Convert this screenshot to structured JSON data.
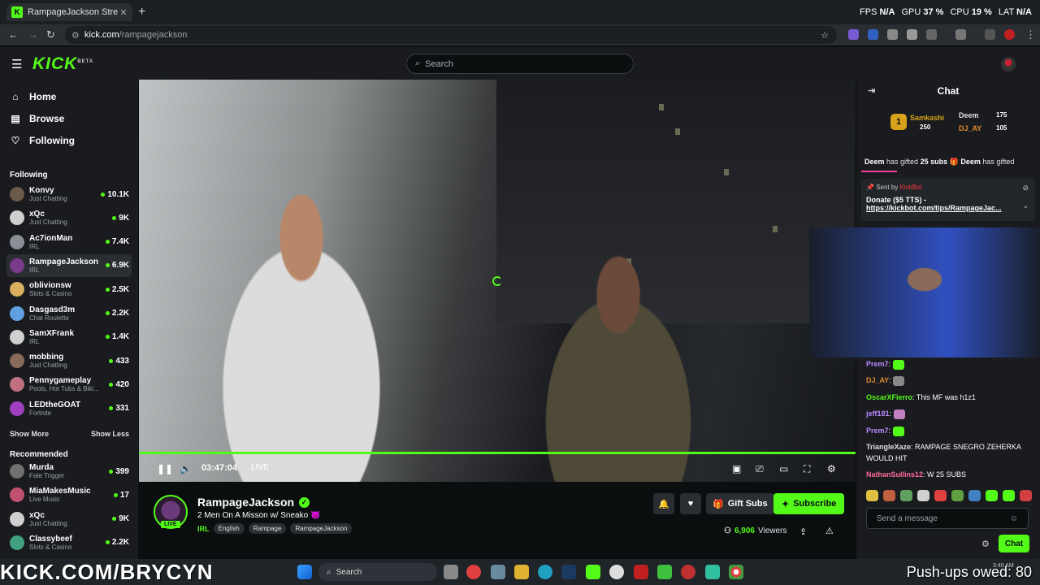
{
  "browser": {
    "tab_title": "RampageJackson Stream - ",
    "url_host": "kick.com",
    "url_path": "/rampagejackson",
    "perf": {
      "fps_label": "FPS",
      "fps": "N/A",
      "gpu_label": "GPU",
      "gpu": "37 %",
      "cpu_label": "CPU",
      "cpu": "19 %",
      "lat_label": "LAT",
      "lat": "N/A"
    }
  },
  "header": {
    "logo": "KICK",
    "logo_sup": "BETA",
    "search_placeholder": "Search"
  },
  "sidebar": {
    "nav": [
      {
        "label": "Home"
      },
      {
        "label": "Browse"
      },
      {
        "label": "Following"
      }
    ],
    "following_title": "Following",
    "following": [
      {
        "name": "Konvy",
        "category": "Just Chatting",
        "viewers": "10.1K",
        "color": "#6a5a4a"
      },
      {
        "name": "xQc",
        "category": "Just Chatting",
        "viewers": "9K",
        "color": "#cfcfcf"
      },
      {
        "name": "Ac7ionMan",
        "category": "IRL",
        "viewers": "7.4K",
        "color": "#8a8f95"
      },
      {
        "name": "RampageJackson",
        "category": "IRL",
        "viewers": "6.9K",
        "color": "#7a3a8a"
      },
      {
        "name": "oblivionsw",
        "category": "Slots & Casino",
        "viewers": "2.5K",
        "color": "#d8b060"
      },
      {
        "name": "Dasgasd3m",
        "category": "Chat Roulette",
        "viewers": "2.2K",
        "color": "#60a0e0"
      },
      {
        "name": "SamXFrank",
        "category": "IRL",
        "viewers": "1.4K",
        "color": "#d0d0d0"
      },
      {
        "name": "mobbing",
        "category": "Just Chatting",
        "viewers": "433",
        "color": "#8a6a5a"
      },
      {
        "name": "Pennygameplay",
        "category": "Pools, Hot Tubs & Biki...",
        "viewers": "420",
        "color": "#c07080"
      },
      {
        "name": "LEDtheGOAT",
        "category": "Fortnite",
        "viewers": "331",
        "color": "#a040c0"
      }
    ],
    "show_more": "Show More",
    "show_less": "Show Less",
    "recommended_title": "Recommended",
    "recommended": [
      {
        "name": "Murda",
        "category": "Fate Trigger",
        "viewers": "399",
        "color": "#707070"
      },
      {
        "name": "MiaMakesMusic",
        "category": "Live Music",
        "viewers": "17",
        "color": "#c05070"
      },
      {
        "name": "xQc",
        "category": "Just Chatting",
        "viewers": "9K",
        "color": "#cfcfcf"
      },
      {
        "name": "Classybeef",
        "category": "Slots & Casino",
        "viewers": "2.2K",
        "color": "#40a080"
      }
    ]
  },
  "player": {
    "time": "03:47:04",
    "live": "LIVE",
    "progress": 1.0
  },
  "stream": {
    "streamer": "RampageJackson",
    "title": "2 Men On A Misson w/ Sneako",
    "title_emote": "😈",
    "live_badge": "LIVE",
    "category": "IRL",
    "tags": [
      "English",
      "Rampage",
      "RampageJackson"
    ],
    "gift_label": "Gift Subs",
    "subscribe_label": "Subscribe",
    "viewers": "6,906",
    "viewers_label": "Viewers"
  },
  "chat": {
    "title": "Chat",
    "leaderboard": [
      {
        "rank": "1",
        "name": "Samkashi",
        "count": "250",
        "color": "#d9a21b"
      },
      {
        "name": "Deem",
        "count": "175",
        "color": "#dfe1e4"
      },
      {
        "name": "DJ_AY",
        "count": "105",
        "color": "#e08a30"
      }
    ],
    "gifted_a_user": "Deem",
    "gifted_a_text": "has gifted",
    "gifted_a_count": "25 subs",
    "gifted_b_user": "Deem",
    "gifted_b_text": "has gifted",
    "pinned": {
      "sent_by": "Sent by",
      "bot": "KickBot",
      "donate": "Donate ($5 TTS) -",
      "link": "https://kickbot.com/tips/RampageJac..."
    },
    "messages": [
      {
        "user": "Prem7",
        "text": "",
        "color": "#b889ff",
        "emote": "#53fc18"
      },
      {
        "user": "DJ_AY",
        "text": "",
        "color": "#e08a30",
        "emote": "#888"
      },
      {
        "user": "OscarXFierro",
        "text": "This MF was h1z1",
        "color": "#53fc18"
      },
      {
        "user": "jeff181",
        "text": "",
        "color": "#b889ff",
        "emote": "#c080c0"
      },
      {
        "user": "Prem7",
        "text": "",
        "color": "#b889ff",
        "emote": "#53fc18"
      },
      {
        "user": "TriangleXaze",
        "text": "RAMPAGE SNEGRO ZEHERKA WOULD HIT",
        "color": "#dfe1e4"
      },
      {
        "user": "NathanSullins12",
        "text": "W 25 SUBS",
        "color": "#ff6b9a"
      }
    ],
    "emote_colors": [
      "#e0c040",
      "#c06040",
      "#60a060",
      "#d0d0d0",
      "#e04040",
      "#60a040",
      "#4080c0",
      "#53fc18",
      "#53fc18",
      "#d04040"
    ],
    "input_placeholder": "Send a message",
    "send_label": "Chat"
  },
  "taskbar": {
    "search": "Search",
    "time": "3:40 AM",
    "overlay_left": "KICK.COM/BRYCYN",
    "overlay_right": "Push-ups owed: 80"
  }
}
